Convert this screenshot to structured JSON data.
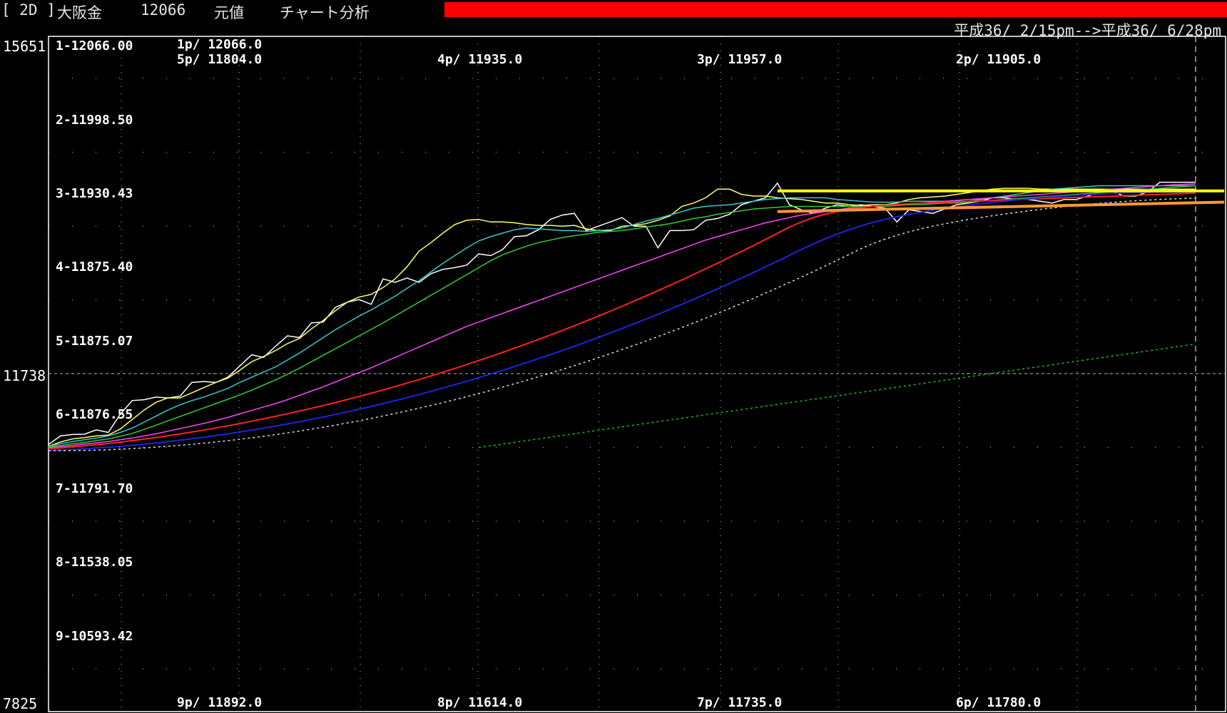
{
  "window": {
    "symbol_tag": "[ 2D ]",
    "instrument": "大阪金",
    "current_value": "12066",
    "price_basis": "元値",
    "mode": "チャート分析",
    "status_bar_color": "#ff0000"
  },
  "date_range": "平成36/ 2/15pm-->平成36/ 6/28pm",
  "chart_data": {
    "type": "line",
    "y_axis": {
      "max_label": "15651",
      "current_label": "11738",
      "min_label": "7825",
      "ylim": [
        7825,
        15651
      ]
    },
    "levels": [
      {
        "label": "1-12066.00"
      },
      {
        "label": "2-11998.50"
      },
      {
        "label": "3-11930.43"
      },
      {
        "label": "4-11875.40"
      },
      {
        "label": "5-11875.07"
      },
      {
        "label": "6-11876.55"
      },
      {
        "label": "7-11791.70"
      },
      {
        "label": "8-11538.05"
      },
      {
        "label": "9-10593.42"
      }
    ],
    "period_labels": [
      "1p/ 12066.0",
      "5p/ 11804.0",
      "4p/ 11935.0",
      "3p/ 11957.0",
      "2p/ 11905.0",
      "9p/ 11892.0",
      "8p/ 11614.0",
      "7p/ 11735.0",
      "6p/ 11780.0"
    ],
    "x": [
      0,
      1,
      2,
      3,
      4,
      5,
      6,
      7,
      8,
      9,
      10,
      11,
      12,
      13,
      14,
      15,
      16,
      17,
      18,
      19,
      20,
      21,
      22,
      23,
      24,
      25,
      26,
      27,
      28,
      29,
      30,
      31,
      32,
      33,
      34,
      35,
      36,
      37,
      38,
      39,
      40,
      41,
      42,
      43,
      44,
      45,
      46,
      47,
      48,
      49,
      50,
      51,
      52,
      53,
      54,
      55,
      56,
      57,
      58,
      59,
      60,
      61,
      62,
      63,
      64,
      65,
      66,
      67,
      68,
      69,
      70,
      71,
      72,
      73,
      74,
      75,
      76,
      77,
      78,
      79,
      80,
      81,
      82,
      83,
      84,
      85,
      86,
      87,
      88,
      89,
      90,
      91,
      92,
      93,
      94,
      95,
      96
    ],
    "series": [
      {
        "color": "#ffffff",
        "style": "solid",
        "values": [
          10920,
          11020,
          11036,
          11040,
          11090,
          11060,
          11270,
          11430,
          11440,
          11470,
          11460,
          11480,
          11640,
          11650,
          11640,
          11700,
          11830,
          11960,
          11930,
          12060,
          12180,
          12160,
          12330,
          12340,
          12510,
          12570,
          12600,
          12545,
          12840,
          12800,
          12850,
          12800,
          12900,
          12950,
          12970,
          13000,
          13130,
          13110,
          13180,
          13330,
          13340,
          13410,
          13530,
          13580,
          13600,
          13400,
          13450,
          13500,
          13550,
          13450,
          13450,
          13200,
          13400,
          13400,
          13410,
          13520,
          13540,
          13590,
          13700,
          13740,
          13780,
          13950,
          13700,
          13640,
          13600,
          13660,
          13700,
          13680,
          13700,
          13680,
          13660,
          13500,
          13640,
          13620,
          13600,
          13650,
          13700,
          13720,
          13740,
          13780,
          13780,
          13760,
          13760,
          13740,
          13720,
          13760,
          13760,
          13800,
          13860,
          13860,
          13800,
          13800,
          13850,
          13960,
          13960,
          13960,
          13960
        ]
      },
      {
        "color": "#ffff66",
        "style": "solid",
        "values": [
          10900,
          10950,
          10985,
          11000,
          11020,
          11030,
          11100,
          11210,
          11320,
          11410,
          11460,
          11460,
          11520,
          11580,
          11640,
          11690,
          11780,
          11880,
          11940,
          12010,
          12090,
          12150,
          12260,
          12360,
          12470,
          12570,
          12630,
          12660,
          12740,
          12840,
          12980,
          13160,
          13260,
          13370,
          13470,
          13520,
          13530,
          13500,
          13500,
          13490,
          13470,
          13460,
          13460,
          13450,
          13460,
          13420,
          13400,
          13400,
          13450,
          13460,
          13480,
          13520,
          13570,
          13680,
          13720,
          13780,
          13880,
          13880,
          13820,
          13800,
          13800,
          13780,
          13770,
          13760,
          13740,
          13720,
          13720,
          13700,
          13690,
          13700,
          13700,
          13720,
          13760,
          13780,
          13790,
          13800,
          13820,
          13840,
          13860,
          13880,
          13890,
          13890,
          13890,
          13880,
          13880,
          13880,
          13880,
          13880,
          13880,
          13880,
          13880,
          13880,
          13880,
          13880,
          13880,
          13880,
          13880
        ]
      },
      {
        "color": "#33cccc",
        "style": "solid",
        "values": [
          10900,
          10930,
          10955,
          10975,
          10995,
          11020,
          11060,
          11110,
          11180,
          11250,
          11320,
          11380,
          11430,
          11470,
          11520,
          11570,
          11640,
          11700,
          11760,
          11820,
          11900,
          11980,
          12070,
          12160,
          12250,
          12330,
          12410,
          12480,
          12560,
          12640,
          12730,
          12820,
          12920,
          13020,
          13110,
          13200,
          13280,
          13330,
          13370,
          13410,
          13430,
          13420,
          13410,
          13400,
          13400,
          13390,
          13400,
          13410,
          13430,
          13470,
          13510,
          13540,
          13580,
          13620,
          13660,
          13680,
          13690,
          13700,
          13720,
          13740,
          13760,
          13770,
          13780,
          13780,
          13780,
          13780,
          13760,
          13750,
          13740,
          13730,
          13730,
          13730,
          13740,
          13740,
          13740,
          13740,
          13740,
          13740,
          13760,
          13780,
          13800,
          13820,
          13840,
          13860,
          13880,
          13890,
          13900,
          13910,
          13920,
          13920,
          13920,
          13920,
          13920,
          13920,
          13920,
          13920,
          13920
        ]
      },
      {
        "color": "#33cc33",
        "style": "solid",
        "values": [
          10890,
          10910,
          10930,
          10945,
          10965,
          10985,
          11015,
          11050,
          11095,
          11145,
          11195,
          11245,
          11295,
          11345,
          11395,
          11445,
          11495,
          11550,
          11610,
          11670,
          11735,
          11805,
          11880,
          11955,
          12030,
          12105,
          12180,
          12255,
          12330,
          12410,
          12490,
          12570,
          12650,
          12730,
          12810,
          12890,
          12970,
          13050,
          13120,
          13170,
          13220,
          13260,
          13290,
          13320,
          13340,
          13360,
          13380,
          13390,
          13400,
          13420,
          13440,
          13460,
          13480,
          13510,
          13540,
          13560,
          13590,
          13610,
          13630,
          13650,
          13660,
          13670,
          13680,
          13680,
          13680,
          13680,
          13680,
          13680,
          13680,
          13680,
          13680,
          13690,
          13700,
          13700,
          13710,
          13720,
          13720,
          13730,
          13740,
          13750,
          13760,
          13770,
          13780,
          13790,
          13800,
          13810,
          13820,
          13830,
          13840,
          13850,
          13860,
          13870,
          13880,
          13890,
          13900,
          13910,
          13920
        ]
      },
      {
        "color": "#ff44ff",
        "style": "solid",
        "values": [
          10880,
          10895,
          10910,
          10925,
          10940,
          10955,
          10975,
          10995,
          11020,
          11045,
          11075,
          11105,
          11135,
          11165,
          11200,
          11235,
          11275,
          11315,
          11355,
          11395,
          11440,
          11490,
          11540,
          11590,
          11645,
          11700,
          11755,
          11810,
          11870,
          11930,
          11990,
          12050,
          12110,
          12170,
          12230,
          12290,
          12340,
          12390,
          12440,
          12490,
          12540,
          12590,
          12640,
          12690,
          12740,
          12790,
          12840,
          12890,
          12940,
          12990,
          13040,
          13090,
          13140,
          13190,
          13240,
          13290,
          13330,
          13370,
          13410,
          13450,
          13490,
          13520,
          13550,
          13580,
          13600,
          13620,
          13640,
          13660,
          13670,
          13680,
          13690,
          13700,
          13710,
          13720,
          13730,
          13740,
          13750,
          13760,
          13770,
          13780,
          13790,
          13800,
          13810,
          13820,
          13830,
          13840,
          13850,
          13860,
          13870,
          13880,
          13890,
          13900,
          13910,
          13920,
          13930,
          13935,
          13940
        ]
      },
      {
        "color": "#ff2020",
        "style": "solid",
        "values": [
          10870,
          10880,
          10892,
          10905,
          10918,
          10932,
          10948,
          10965,
          10983,
          11002,
          11022,
          11043,
          11065,
          11088,
          11112,
          11137,
          11163,
          11190,
          11218,
          11247,
          11277,
          11308,
          11340,
          11373,
          11407,
          11442,
          11478,
          11515,
          11553,
          11592,
          11632,
          11673,
          11715,
          11758,
          11802,
          11847,
          11893,
          11940,
          11988,
          12037,
          12087,
          12138,
          12190,
          12243,
          12297,
          12352,
          12408,
          12465,
          12523,
          12582,
          12642,
          12703,
          12765,
          12828,
          12892,
          12957,
          13023,
          13090,
          13158,
          13227,
          13297,
          13368,
          13440,
          13500,
          13550,
          13590,
          13620,
          13645,
          13665,
          13680,
          13693,
          13703,
          13711,
          13718,
          13724,
          13729,
          13734,
          13739,
          13744,
          13749,
          13754,
          13759,
          13764,
          13769,
          13774,
          13779,
          13784,
          13789,
          13794,
          13799,
          13804,
          13809,
          13814,
          13819,
          13824,
          13829,
          13834
        ]
      },
      {
        "color": "#2222dd",
        "style": "solid",
        "values": [
          10850,
          10855,
          10862,
          10870,
          10879,
          10889,
          10900,
          10912,
          10925,
          10939,
          10954,
          10970,
          10987,
          11005,
          11024,
          11044,
          11065,
          11087,
          11110,
          11134,
          11159,
          11185,
          11212,
          11240,
          11269,
          11299,
          11330,
          11362,
          11395,
          11429,
          11464,
          11500,
          11537,
          11575,
          11614,
          11654,
          11695,
          11737,
          11780,
          11824,
          11869,
          11915,
          11962,
          12010,
          12059,
          12109,
          12160,
          12212,
          12265,
          12319,
          12374,
          12430,
          12487,
          12545,
          12604,
          12664,
          12725,
          12787,
          12850,
          12914,
          12979,
          13045,
          13112,
          13180,
          13245,
          13305,
          13360,
          13410,
          13455,
          13495,
          13530,
          13560,
          13587,
          13612,
          13635,
          13656,
          13675,
          13693,
          13710,
          13726,
          13741,
          13755,
          13768,
          13780,
          13791,
          13801,
          13810,
          13818,
          13825,
          13831,
          13836,
          13840,
          13843,
          13845,
          13846,
          13847,
          13848
        ]
      },
      {
        "color": "#dddddd",
        "style": "dotted",
        "values": [
          10850,
          10850,
          10850,
          10852,
          10855,
          10860,
          10866,
          10873,
          10881,
          10890,
          10900,
          10911,
          10923,
          10936,
          10950,
          10965,
          10981,
          10998,
          11016,
          11035,
          11055,
          11076,
          11098,
          11121,
          11145,
          11170,
          11196,
          11223,
          11251,
          11280,
          11310,
          11341,
          11373,
          11406,
          11440,
          11475,
          11511,
          11548,
          11586,
          11625,
          11665,
          11706,
          11748,
          11791,
          11835,
          11880,
          11926,
          11973,
          12021,
          12070,
          12120,
          12171,
          12223,
          12276,
          12330,
          12385,
          12441,
          12498,
          12556,
          12615,
          12675,
          12736,
          12798,
          12861,
          12925,
          12990,
          13056,
          13123,
          13191,
          13250,
          13300,
          13345,
          13385,
          13420,
          13451,
          13479,
          13505,
          13529,
          13551,
          13572,
          13592,
          13611,
          13629,
          13646,
          13662,
          13677,
          13691,
          13704,
          13716,
          13727,
          13737,
          13746,
          13754,
          13761,
          13767,
          13772,
          13776
        ]
      },
      {
        "color": "#22bb22",
        "style": "dotted",
        "values": [
          null,
          null,
          null,
          null,
          null,
          null,
          null,
          null,
          null,
          null,
          null,
          null,
          null,
          null,
          null,
          null,
          null,
          null,
          null,
          null,
          null,
          null,
          null,
          null,
          null,
          null,
          null,
          null,
          null,
          null,
          null,
          null,
          null,
          null,
          null,
          null,
          10885,
          10905,
          10925,
          10945,
          10965,
          10985,
          11005,
          11025,
          11045,
          11065,
          11085,
          11105,
          11125,
          11145,
          11165,
          11185,
          11205,
          11225,
          11245,
          11265,
          11285,
          11305,
          11325,
          11345,
          11365,
          11385,
          11405,
          11425,
          11445,
          11465,
          11485,
          11505,
          11525,
          11545,
          11565,
          11585,
          11605,
          11625,
          11645,
          11665,
          11685,
          11705,
          11725,
          11745,
          11765,
          11785,
          11805,
          11825,
          11845,
          11865,
          11885,
          11905,
          11925,
          11945,
          11965,
          11985,
          12005,
          12025,
          12045,
          12065,
          12085
        ]
      }
    ],
    "trend_lines": [
      {
        "color": "#ffff00",
        "from": [
          61,
          13860
        ],
        "to": [
          96,
          13860
        ]
      },
      {
        "color": "#ff9933",
        "from": [
          61,
          13620
        ],
        "to": [
          96,
          13730
        ]
      }
    ],
    "grid": true,
    "legend": "none"
  }
}
